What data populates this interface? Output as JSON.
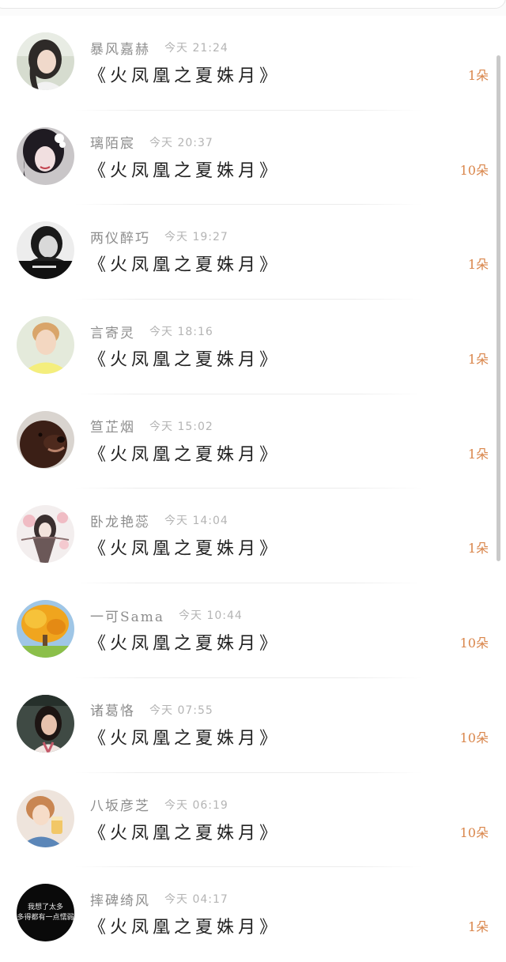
{
  "accent_color": "#d9854a",
  "gifts": [
    {
      "sender": "暴风嘉赫",
      "time": "今天 21:24",
      "book": "《火凤凰之夏姝月》",
      "count": "1朵",
      "avatar_icon": "girl-portrait-avatar"
    },
    {
      "sender": "璃陌宸",
      "time": "今天 20:37",
      "book": "《火凤凰之夏姝月》",
      "count": "10朵",
      "avatar_icon": "girl-flower-hair-avatar"
    },
    {
      "sender": "两仪醉巧",
      "time": "今天 19:27",
      "book": "《火凤凰之夏姝月》",
      "count": "1朵",
      "avatar_icon": "bw-portrait-avatar"
    },
    {
      "sender": "言寄灵",
      "time": "今天 18:16",
      "book": "《火凤凰之夏姝月》",
      "count": "1朵",
      "avatar_icon": "boy-yellow-shirt-avatar"
    },
    {
      "sender": "笪芷烟",
      "time": "今天 15:02",
      "book": "《火凤凰之夏姝月》",
      "count": "1朵",
      "avatar_icon": "dog-avatar"
    },
    {
      "sender": "卧龙艳蕊",
      "time": "今天 14:04",
      "book": "《火凤凰之夏姝月》",
      "count": "1朵",
      "avatar_icon": "anime-blossom-avatar"
    },
    {
      "sender": "一可Sama",
      "time": "今天 10:44",
      "book": "《火凤凰之夏姝月》",
      "count": "10朵",
      "avatar_icon": "autumn-tree-avatar"
    },
    {
      "sender": "诸葛恪",
      "time": "今天 07:55",
      "book": "《火凤凰之夏姝月》",
      "count": "10朵",
      "avatar_icon": "woman-portrait-avatar"
    },
    {
      "sender": "八坂彦芝",
      "time": "今天 06:19",
      "book": "《火凤凰之夏姝月》",
      "count": "10朵",
      "avatar_icon": "girl-drink-avatar"
    },
    {
      "sender": "摔碑绮风",
      "time": "今天 04:17",
      "book": "《火凤凰之夏姝月》",
      "count": "1朵",
      "avatar_icon": "text-quote-avatar",
      "avatar_text": [
        "我想了太多",
        "多得都有一点懦弱"
      ]
    }
  ]
}
